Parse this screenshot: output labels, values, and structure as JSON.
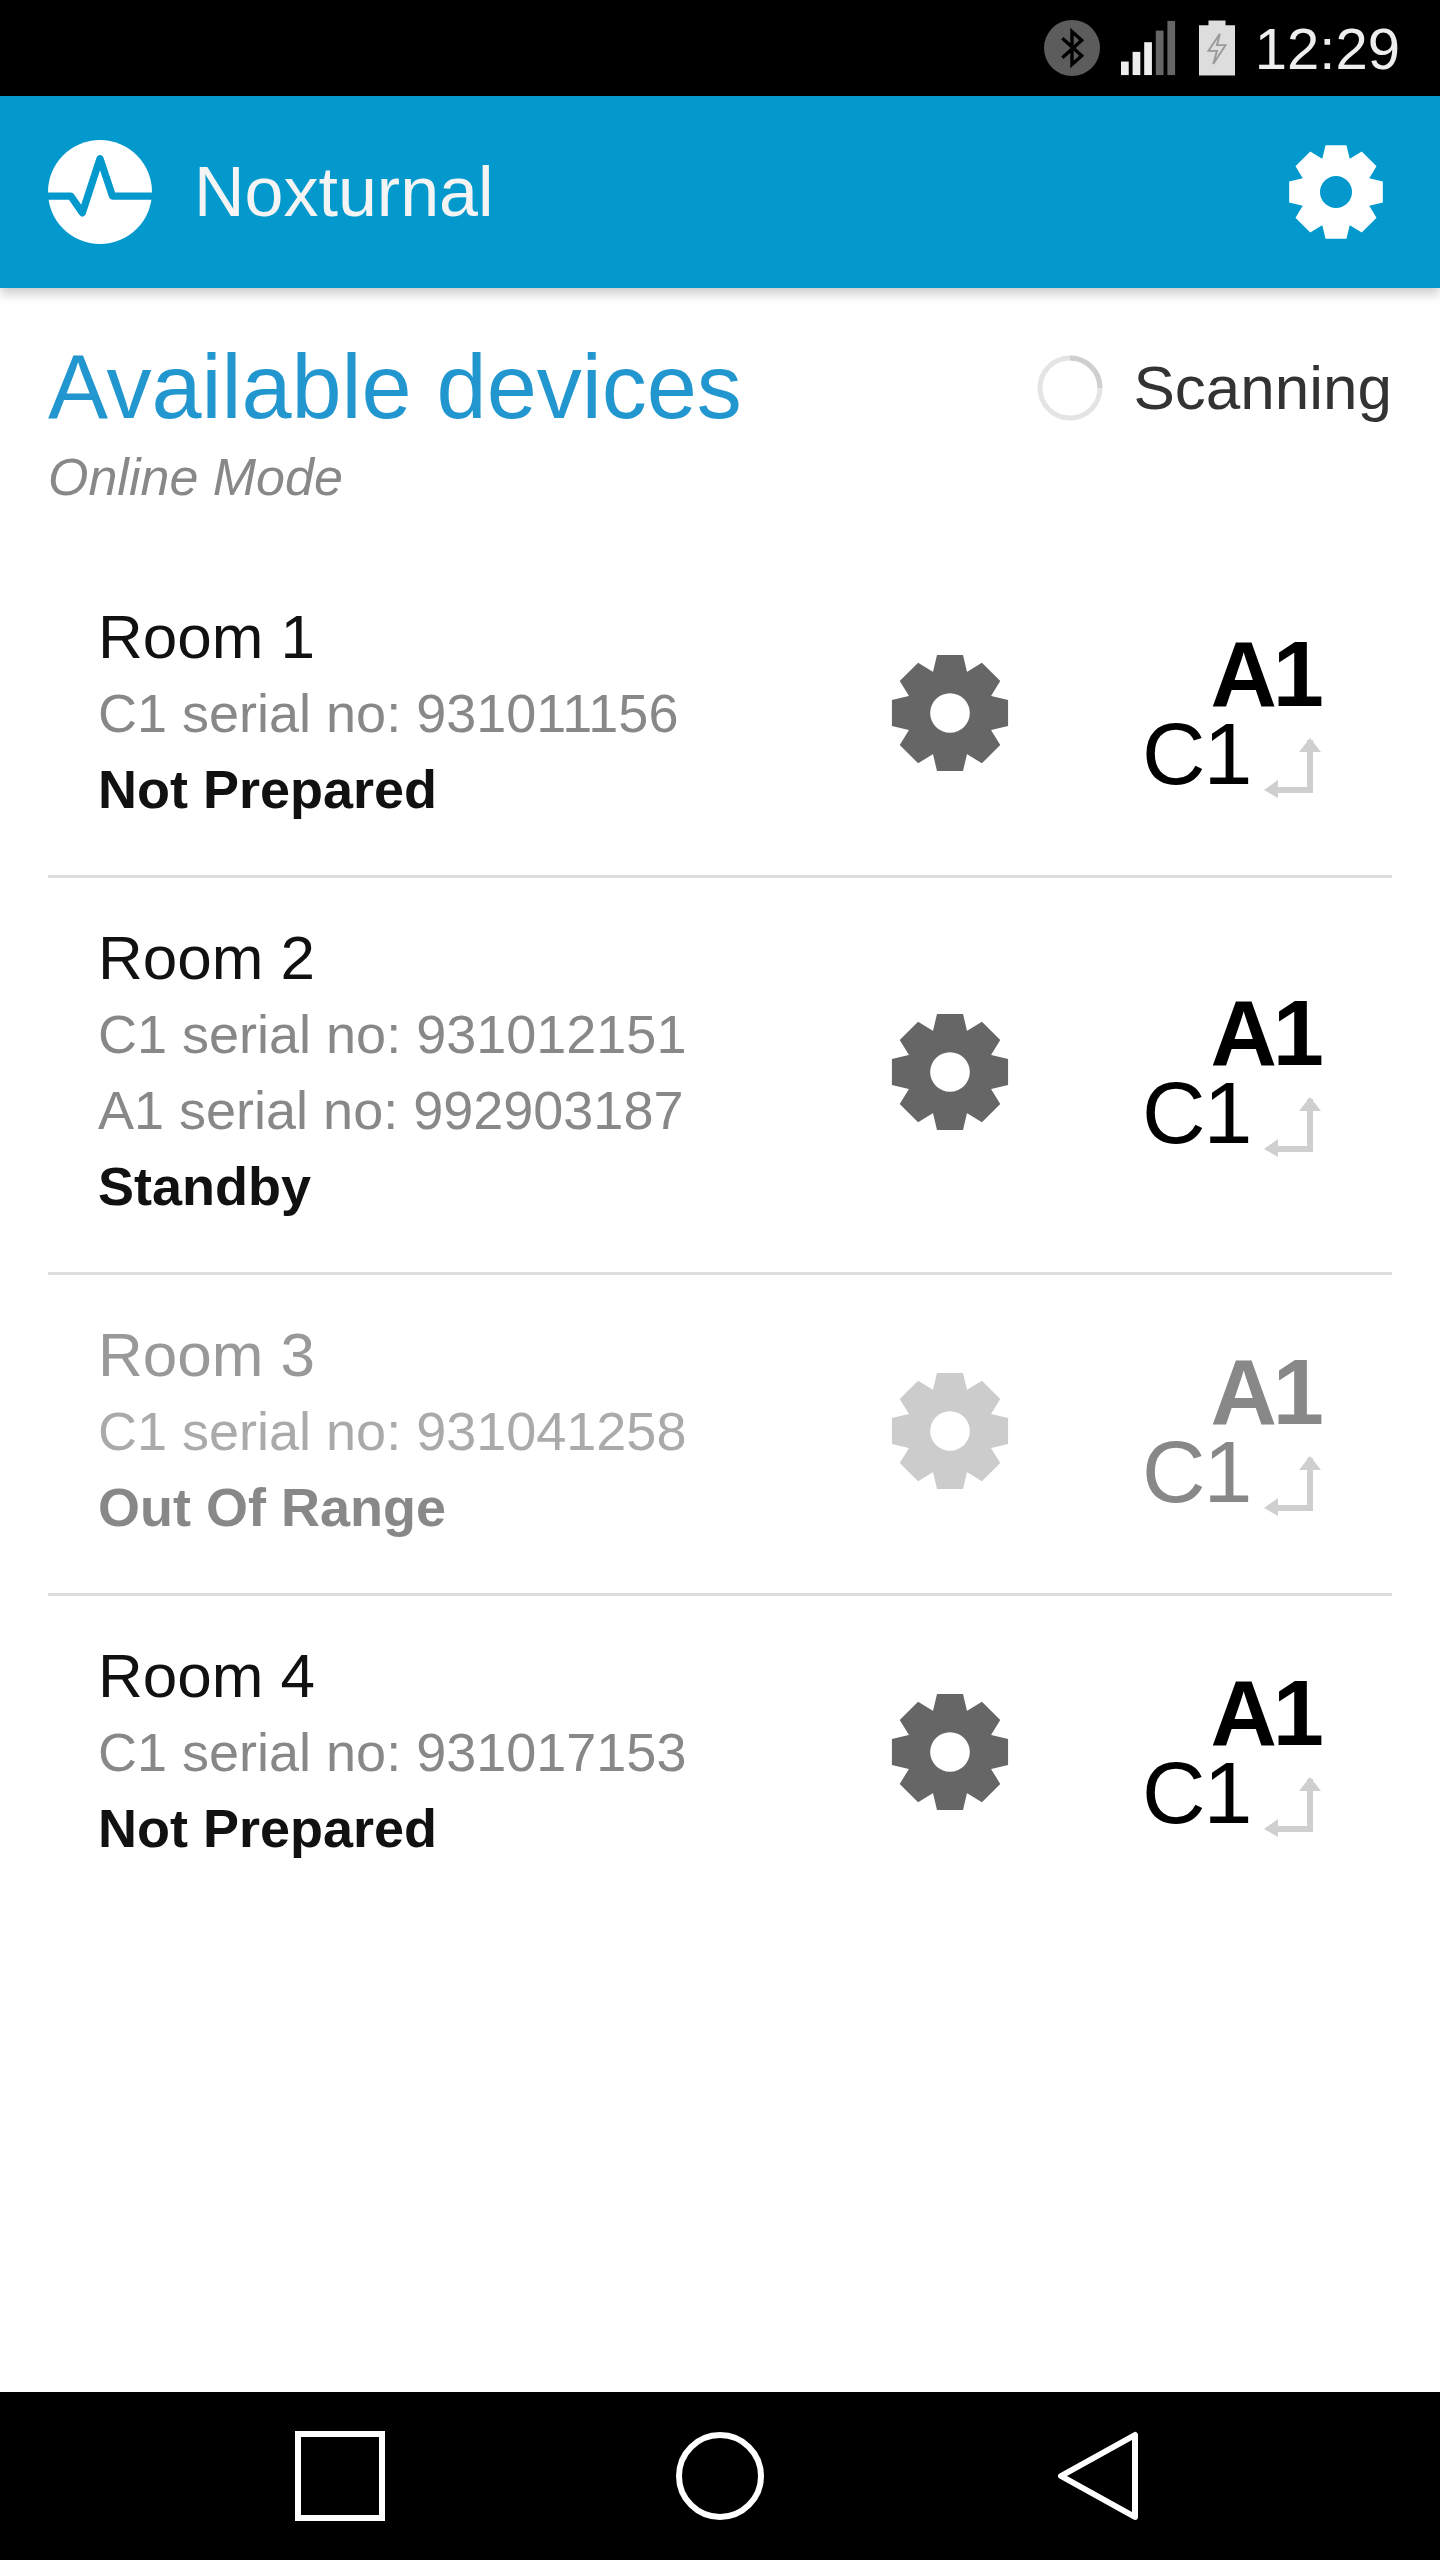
{
  "status_bar": {
    "time": "12:29"
  },
  "app_bar": {
    "title": "Noxturnal"
  },
  "header": {
    "title": "Available devices",
    "mode": "Online Mode",
    "scan_label": "Scanning"
  },
  "devices": [
    {
      "name": "Room 1",
      "serials": [
        "C1 serial no: 931011156"
      ],
      "status": "Not Prepared",
      "disabled": false,
      "badge_top": "A1",
      "badge_bottom": "C1"
    },
    {
      "name": "Room 2",
      "serials": [
        "C1 serial no: 931012151",
        "A1 serial no: 992903187"
      ],
      "status": "Standby",
      "disabled": false,
      "badge_top": "A1",
      "badge_bottom": "C1"
    },
    {
      "name": "Room 3",
      "serials": [
        "C1 serial no: 931041258"
      ],
      "status": "Out Of Range",
      "disabled": true,
      "badge_top": "A1",
      "badge_bottom": "C1"
    },
    {
      "name": "Room 4",
      "serials": [
        "C1 serial no: 931017153"
      ],
      "status": "Not Prepared",
      "disabled": false,
      "badge_top": "A1",
      "badge_bottom": "C1"
    }
  ]
}
